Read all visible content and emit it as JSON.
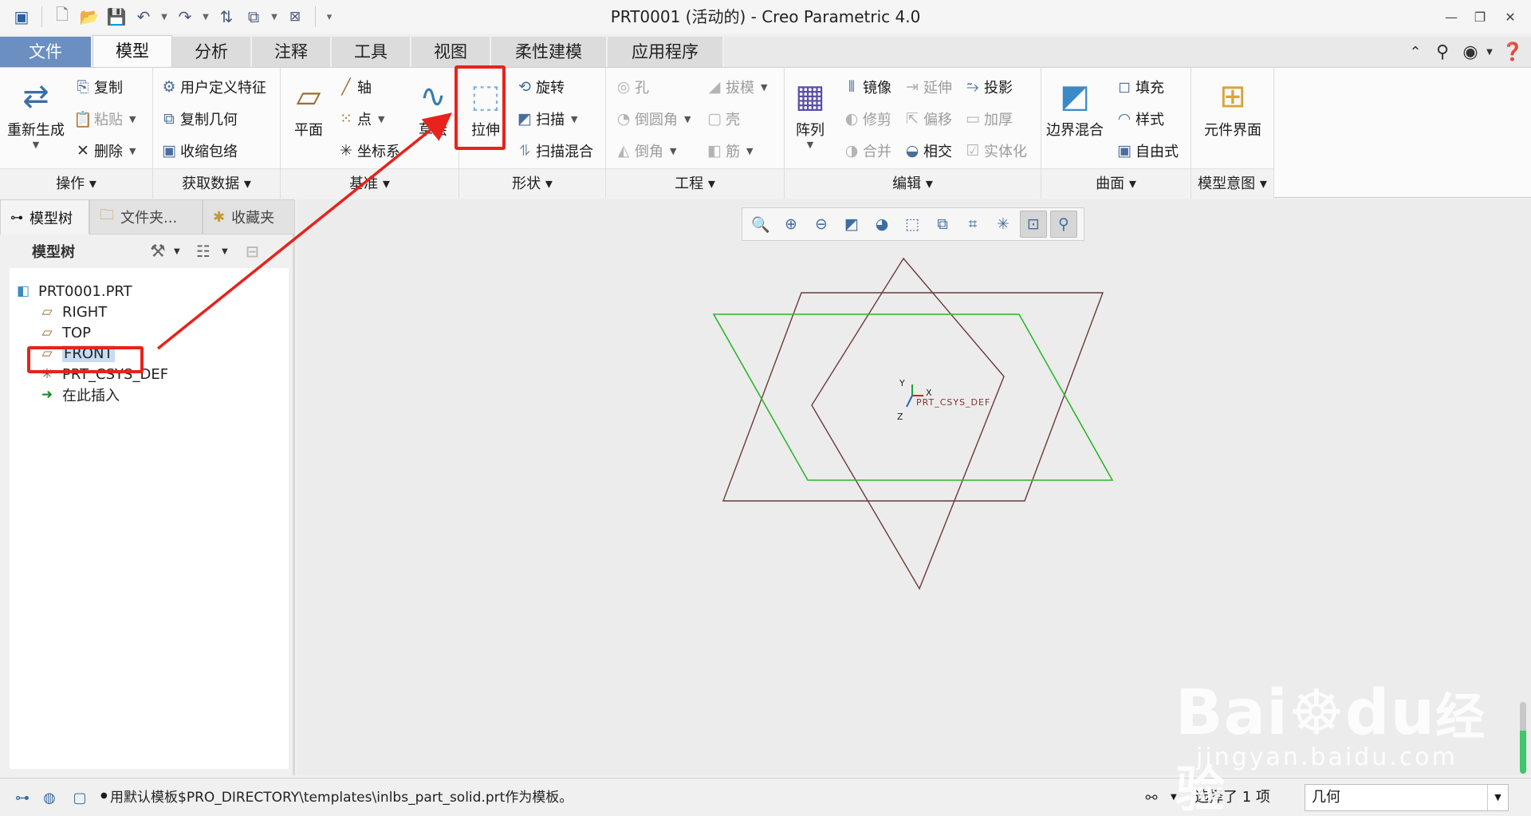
{
  "window": {
    "title": "PRT0001 (活动的) - Creo Parametric 4.0",
    "controls": {
      "minimize": "—",
      "restore": "❐",
      "close": "✕"
    }
  },
  "quick_access": {
    "icons": [
      "app-icon",
      "new-icon",
      "open-icon",
      "save-icon",
      "undo-icon",
      "redo-icon",
      "regenerate-icon",
      "windows-icon",
      "close-window-icon",
      "customize-icon"
    ]
  },
  "tabs": [
    {
      "label": "文件"
    },
    {
      "label": "模型"
    },
    {
      "label": "分析"
    },
    {
      "label": "注释"
    },
    {
      "label": "工具"
    },
    {
      "label": "视图"
    },
    {
      "label": "柔性建模"
    },
    {
      "label": "应用程序"
    }
  ],
  "ribbon": {
    "operations": {
      "label": "操作",
      "regenerate": "重新生成",
      "copy": "复制",
      "paste": "粘贴",
      "delete": "删除"
    },
    "get_data": {
      "label": "获取数据",
      "udf": "用户定义特征",
      "copy_geom": "复制几何",
      "shrinkwrap": "收缩包络"
    },
    "datum": {
      "label": "基准",
      "plane": "平面",
      "axis": "轴",
      "point": "点",
      "csys": "坐标系",
      "sketch": "草绘"
    },
    "shapes": {
      "label": "形状",
      "extrude": "拉伸",
      "revolve": "旋转",
      "sweep": "扫描",
      "swept_blend": "扫描混合"
    },
    "engineering": {
      "label": "工程",
      "hole": "孔",
      "round": "倒圆角",
      "chamfer": "倒角",
      "draft": "拔模",
      "shell": "壳",
      "rib": "筋"
    },
    "editing": {
      "label": "编辑",
      "pattern": "阵列",
      "mirror": "镜像",
      "trim": "修剪",
      "merge": "合并",
      "extend": "延伸",
      "offset": "偏移",
      "intersect": "相交",
      "project": "投影",
      "thicken": "加厚",
      "solidify": "实体化"
    },
    "surfaces": {
      "label": "曲面",
      "boundary_blend": "边界混合",
      "fill": "填充",
      "style": "样式",
      "freestyle": "自由式"
    },
    "model_intent": {
      "label": "模型意图",
      "component_interface": "元件界面"
    }
  },
  "panel": {
    "tabs": [
      {
        "label": "模型树"
      },
      {
        "label": "文件夹..."
      },
      {
        "label": "收藏夹"
      }
    ],
    "header": "模型树",
    "tree": [
      {
        "label": "PRT0001.PRT",
        "icon": "part-icon"
      },
      {
        "label": "RIGHT",
        "icon": "datum-plane-icon"
      },
      {
        "label": "TOP",
        "icon": "datum-plane-icon"
      },
      {
        "label": "FRONT",
        "icon": "datum-plane-icon",
        "selected": true
      },
      {
        "label": "PRT_CSYS_DEF",
        "icon": "csys-icon"
      },
      {
        "label": "在此插入",
        "icon": "insert-arrow-icon"
      }
    ]
  },
  "graphics": {
    "csys_label": "PRT_CSYS_DEF",
    "axis_x": "X",
    "axis_y": "Y",
    "axis_z": "Z",
    "colors": {
      "front_plane": "#2db52d",
      "other_planes": "#6b3a3a",
      "highlight": "#e8221c"
    }
  },
  "status": {
    "message": "用默认模板$PRO_DIRECTORY\\templates\\inlbs_part_solid.prt作为模板。",
    "selection": "选择了 1 项",
    "filter": "几何"
  },
  "watermark": {
    "brand": "Bai",
    "brand_suffix": "du",
    "brand_cn": "经验",
    "url": "jingyan.baidu.com"
  }
}
